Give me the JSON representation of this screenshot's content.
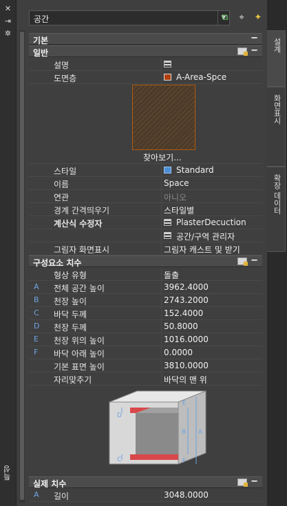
{
  "left_strip": {
    "title": "특성",
    "icons": [
      "close-icon",
      "auto-hide-icon",
      "settings-icon"
    ]
  },
  "toolbar": {
    "object_type": "공간"
  },
  "sections": {
    "basic": "기본",
    "general": "일반",
    "component_dims": "구성요소 치수",
    "actual_dims": "실제 치수"
  },
  "general": {
    "description_label": "설명",
    "layer_label": "도면층",
    "layer_value": "A-Area-Spce",
    "browse": "찾아보기...",
    "style_label": "스타일",
    "style_value": "Standard",
    "name_label": "이름",
    "name_value": "Space",
    "assoc_label": "연관",
    "assoc_value": "아니오",
    "boundary_label": "경계 간격띄우기",
    "boundary_value": "스타일별",
    "calc_label": "계산식 수정자",
    "calc_value": "PlasterDecuction",
    "calc_value2": "공간/구역 관리자",
    "shadow_label": "그림자 화면표시",
    "shadow_value": "그림자 캐스트 및 받기"
  },
  "dims": {
    "rows": [
      {
        "letter": "",
        "label": "형상 유형",
        "value": "돌출"
      },
      {
        "letter": "A",
        "label": "전체 공간 높이",
        "value": "3962.4000"
      },
      {
        "letter": "B",
        "label": "천장 높이",
        "value": "2743.2000"
      },
      {
        "letter": "C",
        "label": "바닥 두께",
        "value": "152.4000"
      },
      {
        "letter": "D",
        "label": "천장 두께",
        "value": "50.8000"
      },
      {
        "letter": "E",
        "label": "천장 위의 높이",
        "value": "1016.0000"
      },
      {
        "letter": "F",
        "label": "바닥 아래 높이",
        "value": "0.0000"
      },
      {
        "letter": "",
        "label": "기본 표면 높이",
        "value": "3810.0000"
      },
      {
        "letter": "",
        "label": "자리맞추기",
        "value": "바닥의 맨 위"
      }
    ]
  },
  "actual": {
    "letter": "A",
    "label": "길이",
    "value": "3048.0000"
  },
  "diagram_letters": [
    "D",
    "E",
    "B",
    "A",
    "C",
    "F"
  ],
  "tabs": {
    "design": "설계",
    "display": "화면표시",
    "extended": "확장 데이터"
  }
}
